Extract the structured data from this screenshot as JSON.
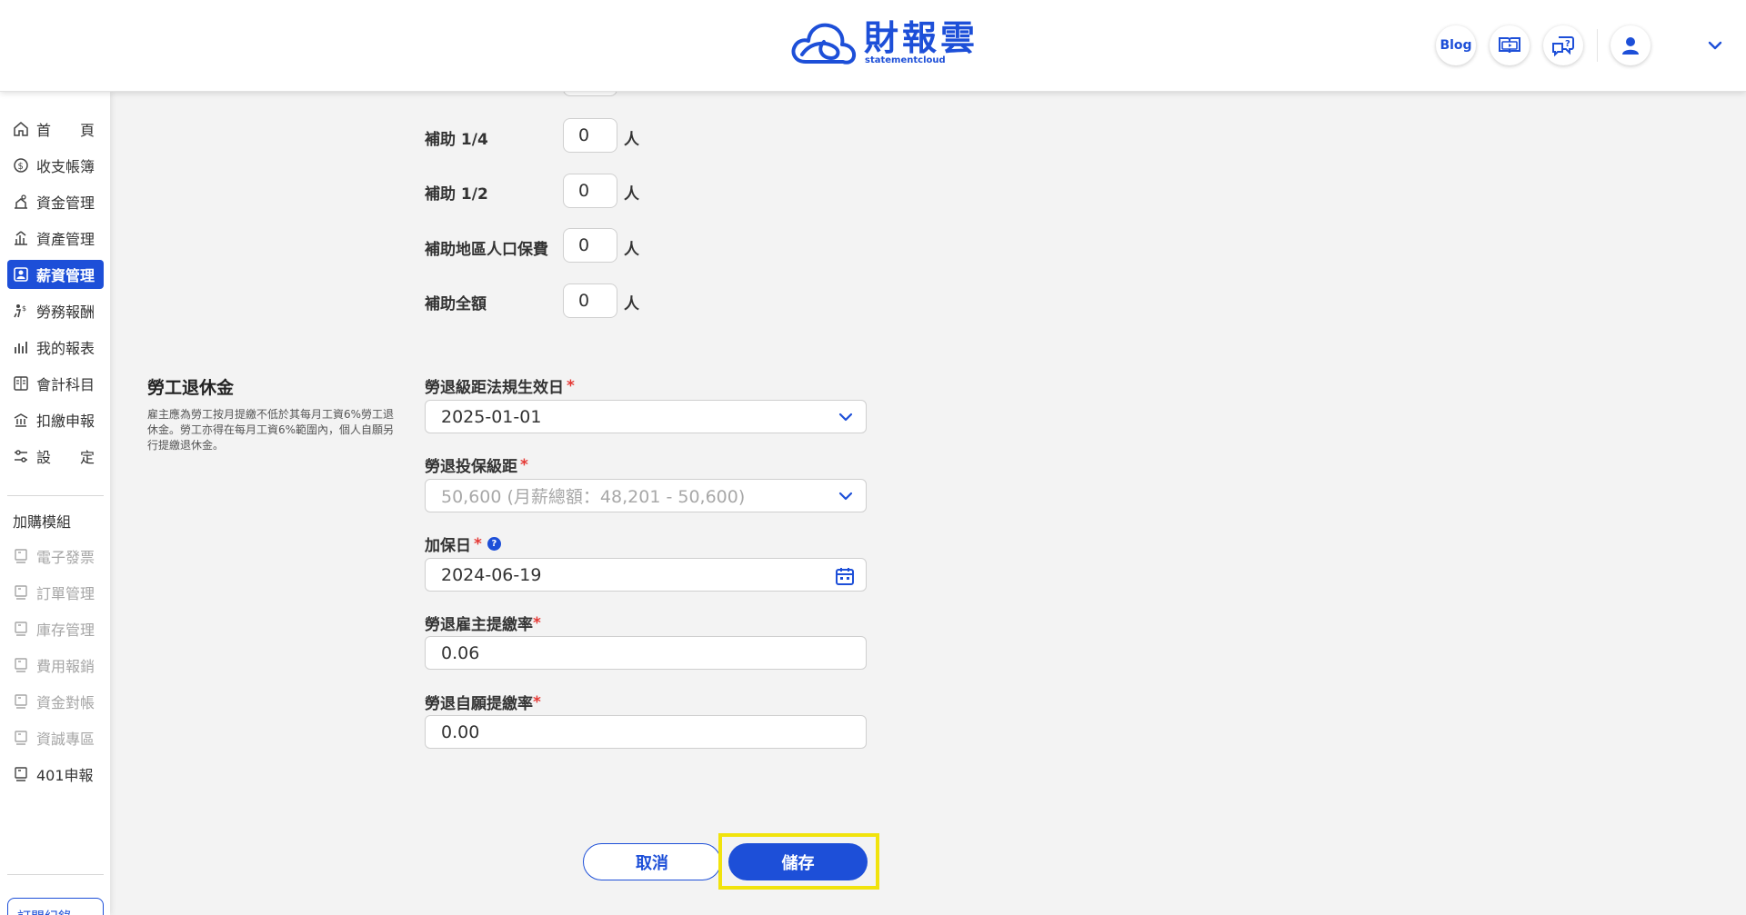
{
  "app": {
    "logo_cn": "財報雲",
    "logo_en": "statementcloud"
  },
  "header": {
    "blog_label": "Blog"
  },
  "sidebar": {
    "items": [
      {
        "label": "首 頁",
        "icon": "home-icon"
      },
      {
        "label": "收支帳簿",
        "icon": "coin-icon"
      },
      {
        "label": "資金管理",
        "icon": "money-bag-icon"
      },
      {
        "label": "資產管理",
        "icon": "assets-icon"
      },
      {
        "label": "薪資管理",
        "icon": "payroll-icon",
        "active": true
      },
      {
        "label": "勞務報酬",
        "icon": "labor-icon"
      },
      {
        "label": "我的報表",
        "icon": "chart-icon"
      },
      {
        "label": "會計科目",
        "icon": "ledger-icon"
      },
      {
        "label": "扣繳申報",
        "icon": "tax-icon"
      },
      {
        "label": "設 定",
        "icon": "settings-icon"
      }
    ],
    "addon_heading": "加購模組",
    "addons": [
      {
        "label": "電子發票",
        "enabled": false
      },
      {
        "label": "訂單管理",
        "enabled": false
      },
      {
        "label": "庫存管理",
        "enabled": false
      },
      {
        "label": "費用報銷",
        "enabled": false
      },
      {
        "label": "資金對帳",
        "enabled": false
      },
      {
        "label": "資誠專區",
        "enabled": false
      },
      {
        "label": "401申報",
        "enabled": true
      }
    ],
    "subscription_label": "訂閱紀錄"
  },
  "subsidy": {
    "rows": [
      {
        "label": "補助 1/4",
        "value": "0",
        "unit": "人"
      },
      {
        "label": "補助 1/2",
        "value": "0",
        "unit": "人"
      },
      {
        "label": "補助地區人口保費",
        "value": "0",
        "unit": "人"
      },
      {
        "label": "補助全額",
        "value": "0",
        "unit": "人"
      }
    ]
  },
  "pension": {
    "title": "勞工退休金",
    "description": "雇主應為勞工按月提繳不低於其每月工資6%勞工退休金。勞工亦得在每月工資6%範圍內，個人自願另行提繳退休金。",
    "fields": {
      "effective_date_label": "勞退級距法規生效日",
      "effective_date_value": "2025-01-01",
      "grade_label": "勞退投保級距",
      "grade_value": "50,600 (月薪總額：48,201 - 50,600)",
      "enroll_date_label": "加保日",
      "enroll_date_value": "2024-06-19",
      "employer_rate_label": "勞退雇主提繳率",
      "employer_rate_value": "0.06",
      "voluntary_rate_label": "勞退自願提繳率",
      "voluntary_rate_value": "0.00"
    },
    "required_mark": "*",
    "help_mark": "?"
  },
  "actions": {
    "cancel_label": "取消",
    "save_label": "儲存"
  },
  "colors": {
    "accent": "#1d4fd8",
    "required": "#e53935",
    "highlight": "#f1e30c"
  }
}
